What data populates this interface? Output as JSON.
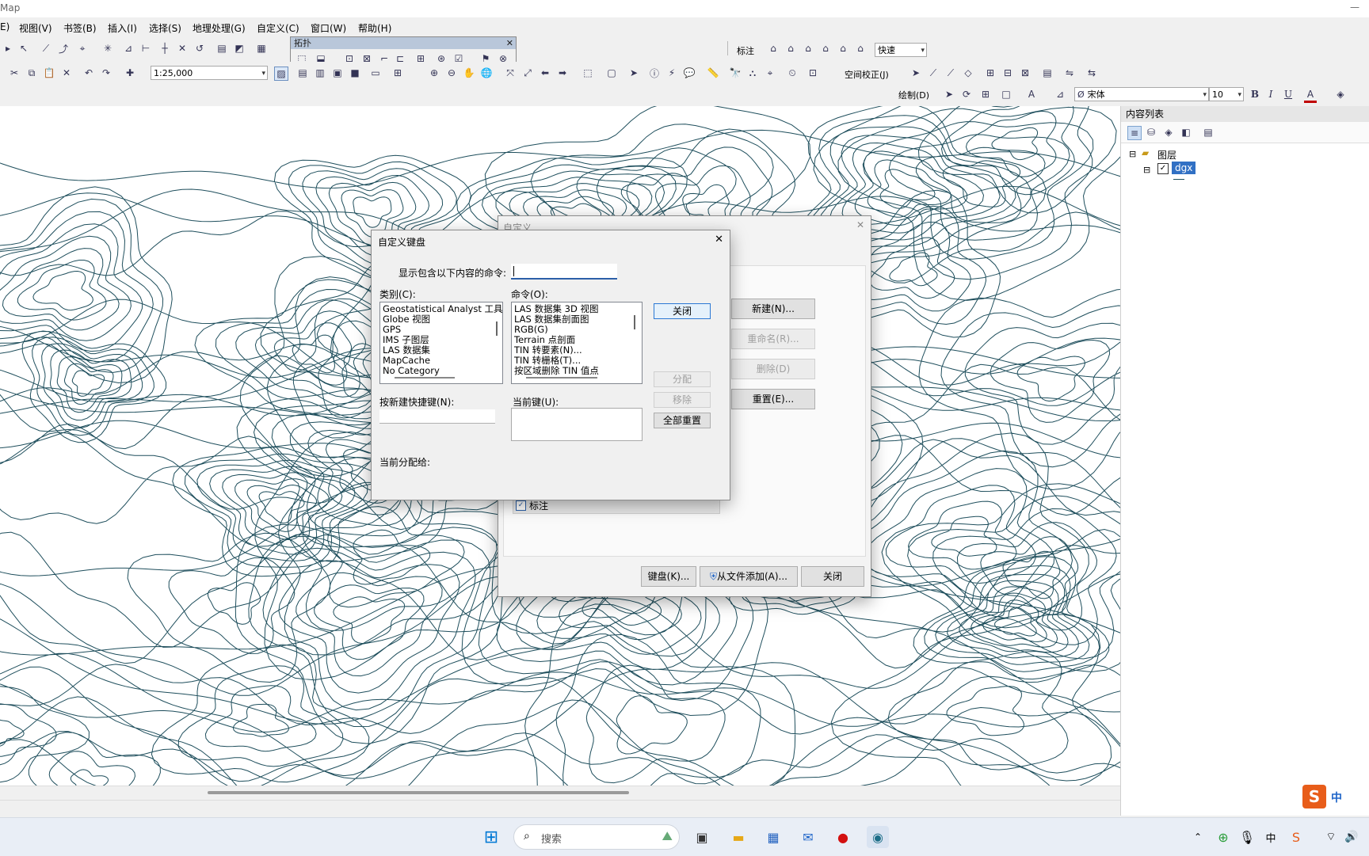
{
  "window": {
    "title_fragment": "Map"
  },
  "menu": [
    "E)",
    "视图(V)",
    "书签(B)",
    "插入(I)",
    "选择(S)",
    "地理处理(G)",
    "自定义(C)",
    "窗口(W)",
    "帮助(H)"
  ],
  "toolbar": {
    "topology_title": "拓扑",
    "annotation_label": "标注",
    "annotation_speed": "快速",
    "scale": "1:25,000",
    "spatial_adjust": "空间校正(J)",
    "draw_label": "绘制(D)",
    "font_name": "宋体",
    "font_size": "10",
    "bold": "B",
    "italic": "I",
    "underline": "U"
  },
  "toc": {
    "title": "内容列表",
    "layers_group": "图层",
    "layer_name": "dgx"
  },
  "customize_dialog": {
    "title": "自定义",
    "new_button": "新建(N)...",
    "rename_button": "重命名(R)...",
    "delete_button": "删除(D)",
    "reset_button": "重置(E)...",
    "toolbar_item_label": "标注",
    "keyboard_button": "键盘(K)...",
    "add_from_file_button": "从文件添加(A)...",
    "close_button": "关闭"
  },
  "keyboard_dialog": {
    "title": "自定义键盘",
    "filter_label": "显示包含以下内容的命令:",
    "filter_value": "",
    "categories_label": "类别(C):",
    "categories": [
      "Geostatistical Analyst 工具",
      "Globe 视图",
      "GPS",
      "IMS 子图层",
      "LAS 数据集",
      "MapCache",
      "No Category"
    ],
    "commands_label": "命令(O):",
    "commands": [
      "LAS 数据集 3D 视图",
      "LAS 数据集剖面图",
      "RGB(G)",
      "Terrain 点剖面",
      "TIN 转要素(N)...",
      "TIN 转栅格(T)...",
      "按区域删除 TIN 值点"
    ],
    "close_button": "关闭",
    "assign_button": "分配",
    "remove_button": "移除",
    "reset_all_button": "全部重置",
    "new_shortcut_label": "按新建快捷键(N):",
    "current_keys_label": "当前键(U):",
    "assigned_to_label": "当前分配给:"
  },
  "taskbar": {
    "search_placeholder": "搜索",
    "ime_lang": "中"
  }
}
